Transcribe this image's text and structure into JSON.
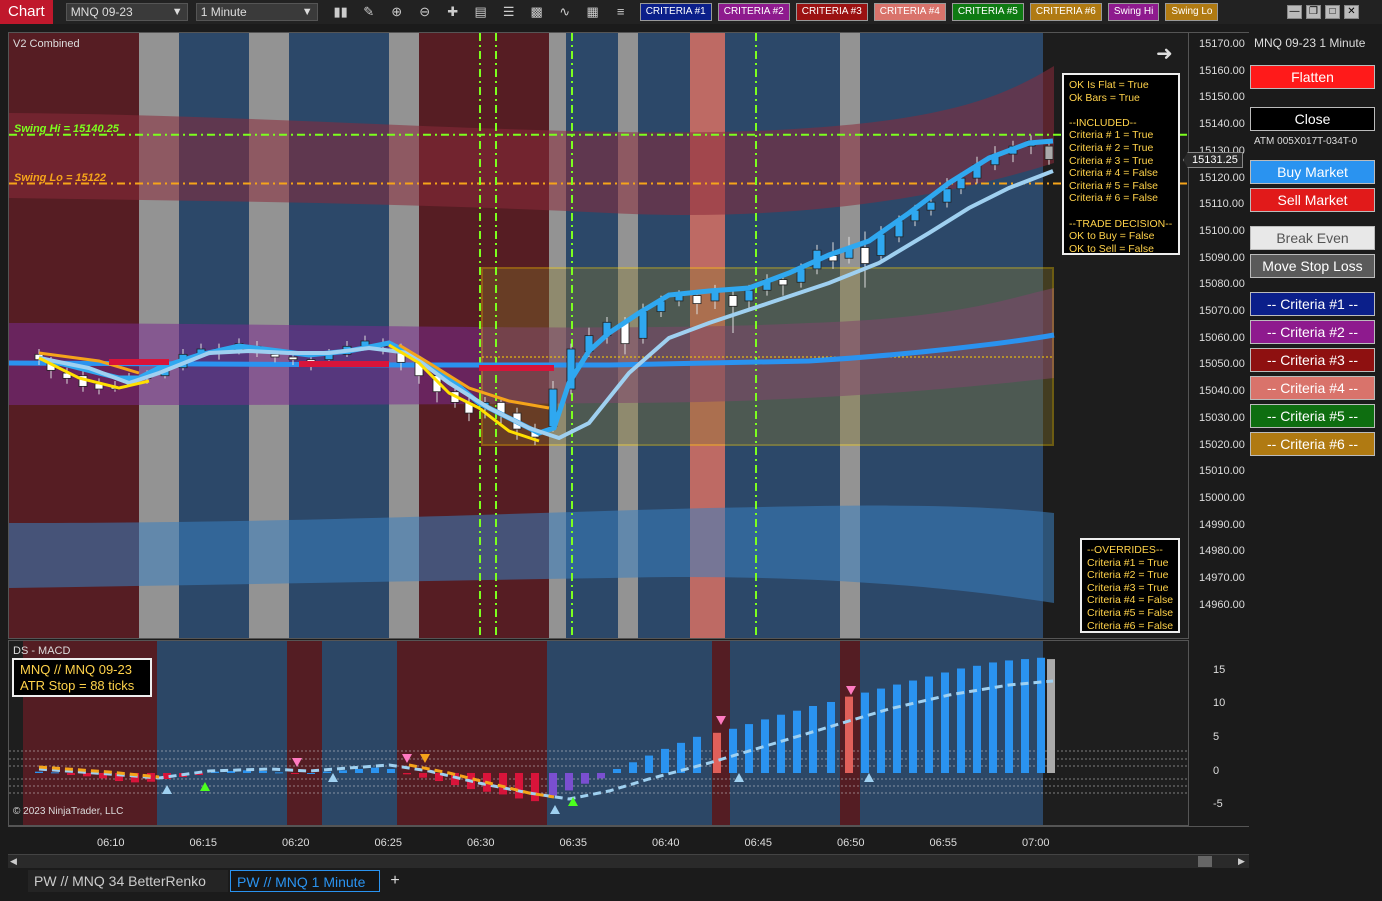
{
  "toolbar": {
    "title": "Chart",
    "instrument": "MNQ 09-23",
    "interval": "1 Minute",
    "tool_icons": [
      "bar-style-icon",
      "pencil-icon",
      "zoom-in-icon",
      "zoom-out-icon",
      "crosshair-icon",
      "data-box-icon",
      "properties-icon",
      "strategies-icon",
      "indicators-icon",
      "templates-icon",
      "menu-icon"
    ],
    "criteria_buttons": [
      {
        "label": "CRITERIA #1",
        "bg": "#0b1f8a"
      },
      {
        "label": "CRITERIA #2",
        "bg": "#8e1a8e"
      },
      {
        "label": "CRITERIA #3",
        "bg": "#9b1212"
      },
      {
        "label": "CRITERIA #4",
        "bg": "#d9736b"
      },
      {
        "label": "CRITERIA #5",
        "bg": "#0e7a12"
      },
      {
        "label": "CRITERIA #6",
        "bg": "#b07a12"
      },
      {
        "label": "Swing Hi",
        "bg": "#8e1a8e"
      },
      {
        "label": "Swing Lo",
        "bg": "#b07a12"
      }
    ]
  },
  "price_panel": {
    "title": "V2 Combined",
    "swing_hi_label": "Swing Hi = 15140.25",
    "swing_lo_label": "Swing Lo = 15122",
    "status_box": "OK Is Flat = True\nOk Bars = True\n\n--INCLUDED--\nCriteria # 1 = True\nCriteria # 2 = True\nCriteria # 3 = True\nCriteria # 4 = False\nCriteria # 5 = False\nCriteria # 6 = False\n\n--TRADE DECISION--\nOK to Buy = False\nOK to Sell = False",
    "overrides_box": "--OVERRIDES--\nCriteria #1 = True\nCriteria #2 = True\nCriteria #3 = True\nCriteria #4 = False\nCriteria #5 = False\nCriteria #6 = False",
    "current_price": "15131.25",
    "price_ticks": [
      "15170.00",
      "15160.00",
      "15150.00",
      "15140.00",
      "15130.00",
      "15120.00",
      "15110.00",
      "15100.00",
      "15090.00",
      "15080.00",
      "15070.00",
      "15060.00",
      "15050.00",
      "15040.00",
      "15030.00",
      "15020.00",
      "15010.00",
      "15000.00",
      "14990.00",
      "14980.00",
      "14970.00",
      "14960.00"
    ]
  },
  "macd_panel": {
    "title": "DS - MACD",
    "info_line1": "MNQ // MNQ 09-23",
    "info_line2": "ATR Stop = 88 ticks",
    "copyright": "© 2023 NinjaTrader, LLC",
    "ticks": [
      "15",
      "10",
      "5",
      "0",
      "-5"
    ]
  },
  "time_axis": {
    "ticks": [
      "06:10",
      "06:15",
      "06:20",
      "06:25",
      "06:30",
      "06:35",
      "06:40",
      "06:45",
      "06:50",
      "06:55",
      "07:00"
    ]
  },
  "side_panel": {
    "title": "MNQ 09-23 1 Minute",
    "atm_label": "ATM  005X017T-034T-0",
    "buttons": [
      {
        "key": "flatten",
        "label": "Flatten",
        "bg": "#ff1a1a",
        "fg": "#fff"
      },
      {
        "key": "close",
        "label": "Close",
        "bg": "#000",
        "fg": "#fff"
      },
      {
        "key": "buy-market",
        "label": "Buy Market",
        "bg": "#2a93f0",
        "fg": "#fff"
      },
      {
        "key": "sell-market",
        "label": "Sell Market",
        "bg": "#e11a1a",
        "fg": "#fff"
      },
      {
        "key": "break-even",
        "label": "Break Even",
        "bg": "#e8e8e8",
        "fg": "#555"
      },
      {
        "key": "move-stop-loss",
        "label": "Move Stop Loss",
        "bg": "#5a5a5a",
        "fg": "#fff"
      },
      {
        "key": "criteria-1",
        "label": "-- Criteria #1 --",
        "bg": "#0b1f8a",
        "fg": "#fff"
      },
      {
        "key": "criteria-2",
        "label": "-- Criteria #2 --",
        "bg": "#8e1a8e",
        "fg": "#fff"
      },
      {
        "key": "criteria-3",
        "label": "-- Criteria #3 --",
        "bg": "#8e1010",
        "fg": "#fff"
      },
      {
        "key": "criteria-4",
        "label": "-- Criteria #4 --",
        "bg": "#d9736b",
        "fg": "#fff"
      },
      {
        "key": "criteria-5",
        "label": "-- Criteria #5 --",
        "bg": "#0e6e10",
        "fg": "#fff"
      },
      {
        "key": "criteria-6",
        "label": "-- Criteria #6 --",
        "bg": "#b07a12",
        "fg": "#fff"
      }
    ]
  },
  "bottom_tabs": [
    {
      "label": "PW // MNQ  34 BetterRenko",
      "active": false
    },
    {
      "label": "PW // MNQ  1 Minute",
      "active": true
    }
  ],
  "add_tab_label": "+",
  "colors": {
    "accent_red": "#c0182c",
    "swing_hi": "#7cff1e",
    "swing_lo": "#f5a41a",
    "candle_blue": "#2fa8f0",
    "trend_light": "#9fd0f0"
  }
}
